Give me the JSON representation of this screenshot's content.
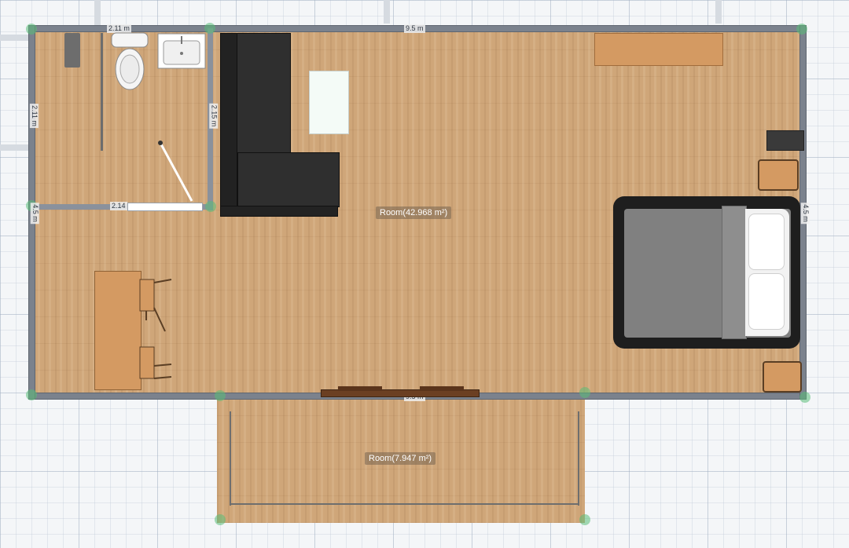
{
  "main_room": {
    "label": "Room(42.968 m²)",
    "dimensions": {
      "top": "9.5 m",
      "bottom": "9.5 m",
      "left": "4.5 m",
      "right": "4.5 m"
    }
  },
  "patio_room": {
    "label": "Room(7.947 m²)"
  },
  "bathroom": {
    "dimensions": {
      "top": "2.11 m",
      "left": "2.11 m",
      "right": "2.15 m",
      "bottom": "2.14"
    }
  },
  "colors": {
    "floor": "#cfa679",
    "wall": "#7b828d",
    "node": "#5abe78",
    "sofa": "#2b2b2b",
    "bed_frame": "#1e1e1e",
    "desk": "#d49a62"
  }
}
